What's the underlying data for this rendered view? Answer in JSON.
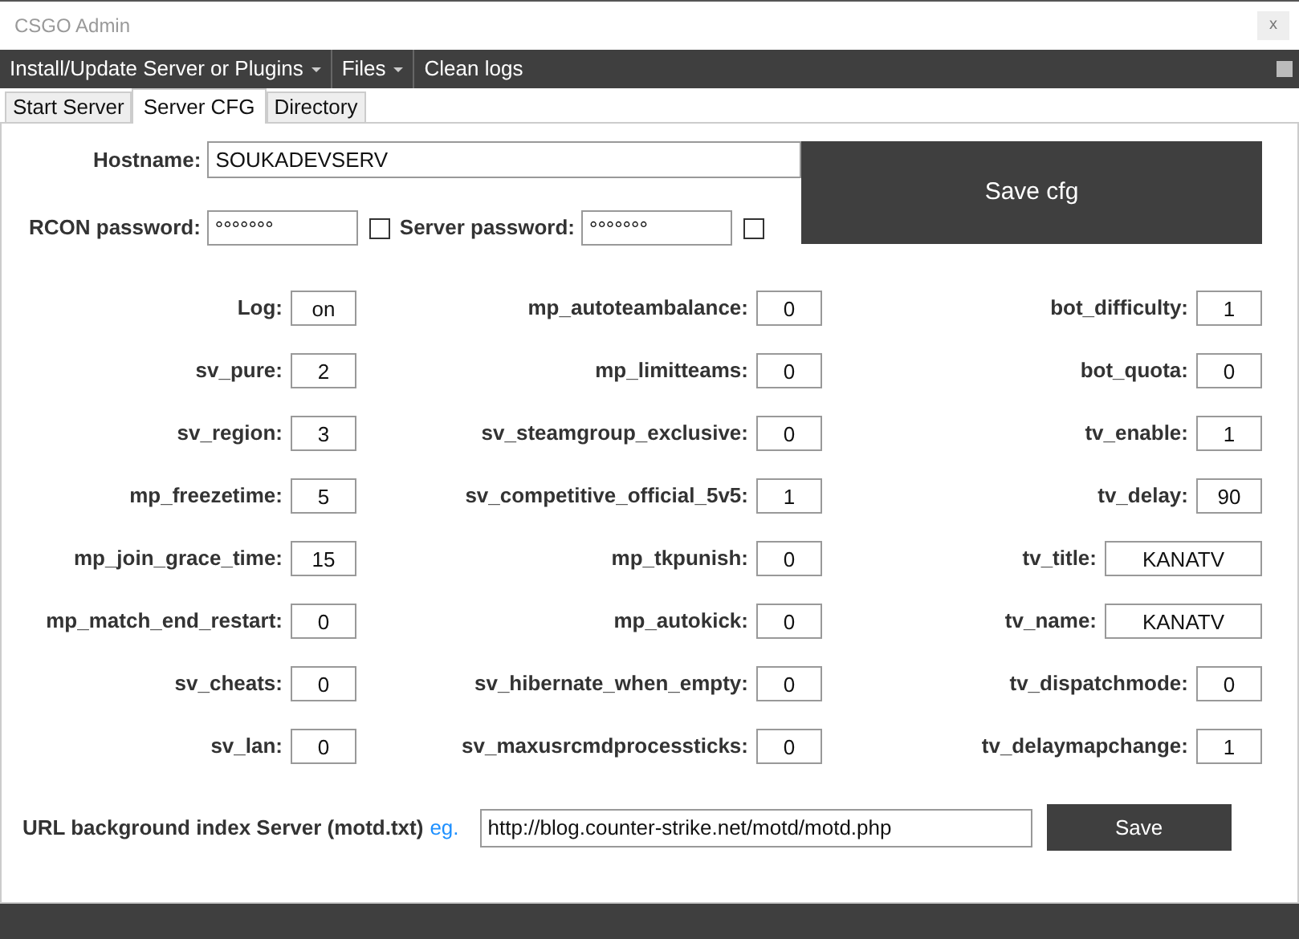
{
  "window": {
    "title": "CSGO Admin",
    "close": "x"
  },
  "menu": [
    {
      "label": "Install/Update Server or Plugins",
      "dropdown": true
    },
    {
      "label": "Files",
      "dropdown": true
    },
    {
      "label": "Clean logs",
      "dropdown": false
    }
  ],
  "tabs": [
    {
      "label": "Start Server",
      "selected": false
    },
    {
      "label": "Server CFG",
      "selected": true
    },
    {
      "label": "Directory",
      "selected": false
    }
  ],
  "hostname": {
    "label": "Hostname:",
    "value": "SOUKADEVSERV"
  },
  "passwords": [
    {
      "label": "RCON password:",
      "value": "°°°°°°°",
      "checked": false
    },
    {
      "label": "Server password:",
      "value": "°°°°°°°",
      "checked": false
    }
  ],
  "save_cfg": "Save cfg",
  "columns": [
    [
      {
        "label": "Log:",
        "value": "on"
      },
      {
        "label": "sv_pure:",
        "value": "2"
      },
      {
        "label": "sv_region:",
        "value": "3"
      },
      {
        "label": "mp_freezetime:",
        "value": "5"
      },
      {
        "label": "mp_join_grace_time:",
        "value": "15"
      },
      {
        "label": "mp_match_end_restart:",
        "value": "0"
      },
      {
        "label": "sv_cheats:",
        "value": "0"
      },
      {
        "label": "sv_lan:",
        "value": "0"
      }
    ],
    [
      {
        "label": "mp_autoteambalance:",
        "value": "0"
      },
      {
        "label": "mp_limitteams:",
        "value": "0"
      },
      {
        "label": "sv_steamgroup_exclusive:",
        "value": "0"
      },
      {
        "label": "sv_competitive_official_5v5:",
        "value": "1"
      },
      {
        "label": "mp_tkpunish:",
        "value": "0"
      },
      {
        "label": "mp_autokick:",
        "value": "0"
      },
      {
        "label": "sv_hibernate_when_empty:",
        "value": "0"
      },
      {
        "label": "sv_maxusrcmdprocessticks:",
        "value": "0"
      }
    ],
    [
      {
        "label": "bot_difficulty:",
        "value": "1"
      },
      {
        "label": "bot_quota:",
        "value": "0"
      },
      {
        "label": "tv_enable:",
        "value": "1"
      },
      {
        "label": "tv_delay:",
        "value": "90"
      },
      {
        "label": "tv_title:",
        "value": "KANATV"
      },
      {
        "label": "tv_name:",
        "value": "KANATV"
      },
      {
        "label": "tv_dispatchmode:",
        "value": "0"
      },
      {
        "label": "tv_delaymapchange:",
        "value": "1"
      }
    ]
  ],
  "motd": {
    "label": "URL background index Server (motd.txt)",
    "link": "eg.",
    "value": "http://blog.counter-strike.net/motd/motd.php",
    "button": "Save"
  }
}
